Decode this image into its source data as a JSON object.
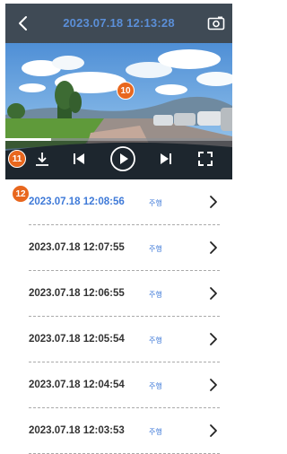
{
  "header": {
    "title": "2023.07.18 12:13:28",
    "back_icon": "chevron-left-icon",
    "capture_icon": "screenshot-camera-icon"
  },
  "player": {
    "progress_fraction": 0.2,
    "controls": [
      "download-icon",
      "skip-previous-icon",
      "play-icon",
      "skip-next-icon",
      "fullscreen-icon"
    ]
  },
  "annotations": {
    "video_badge": "10",
    "download_badge": "11",
    "list_badge": "12"
  },
  "recordings": [
    {
      "time": "2023.07.18 12:08:56",
      "type": "주행",
      "active": true
    },
    {
      "time": "2023.07.18 12:07:55",
      "type": "주행",
      "active": false
    },
    {
      "time": "2023.07.18 12:06:55",
      "type": "주행",
      "active": false
    },
    {
      "time": "2023.07.18 12:05:54",
      "type": "주행",
      "active": false
    },
    {
      "time": "2023.07.18 12:04:54",
      "type": "주행",
      "active": false
    },
    {
      "time": "2023.07.18 12:03:53",
      "type": "주행",
      "active": false
    }
  ],
  "colors": {
    "header_bg": "#3f4a55",
    "accent": "#3f7ad8",
    "badge": "#e8671e"
  }
}
